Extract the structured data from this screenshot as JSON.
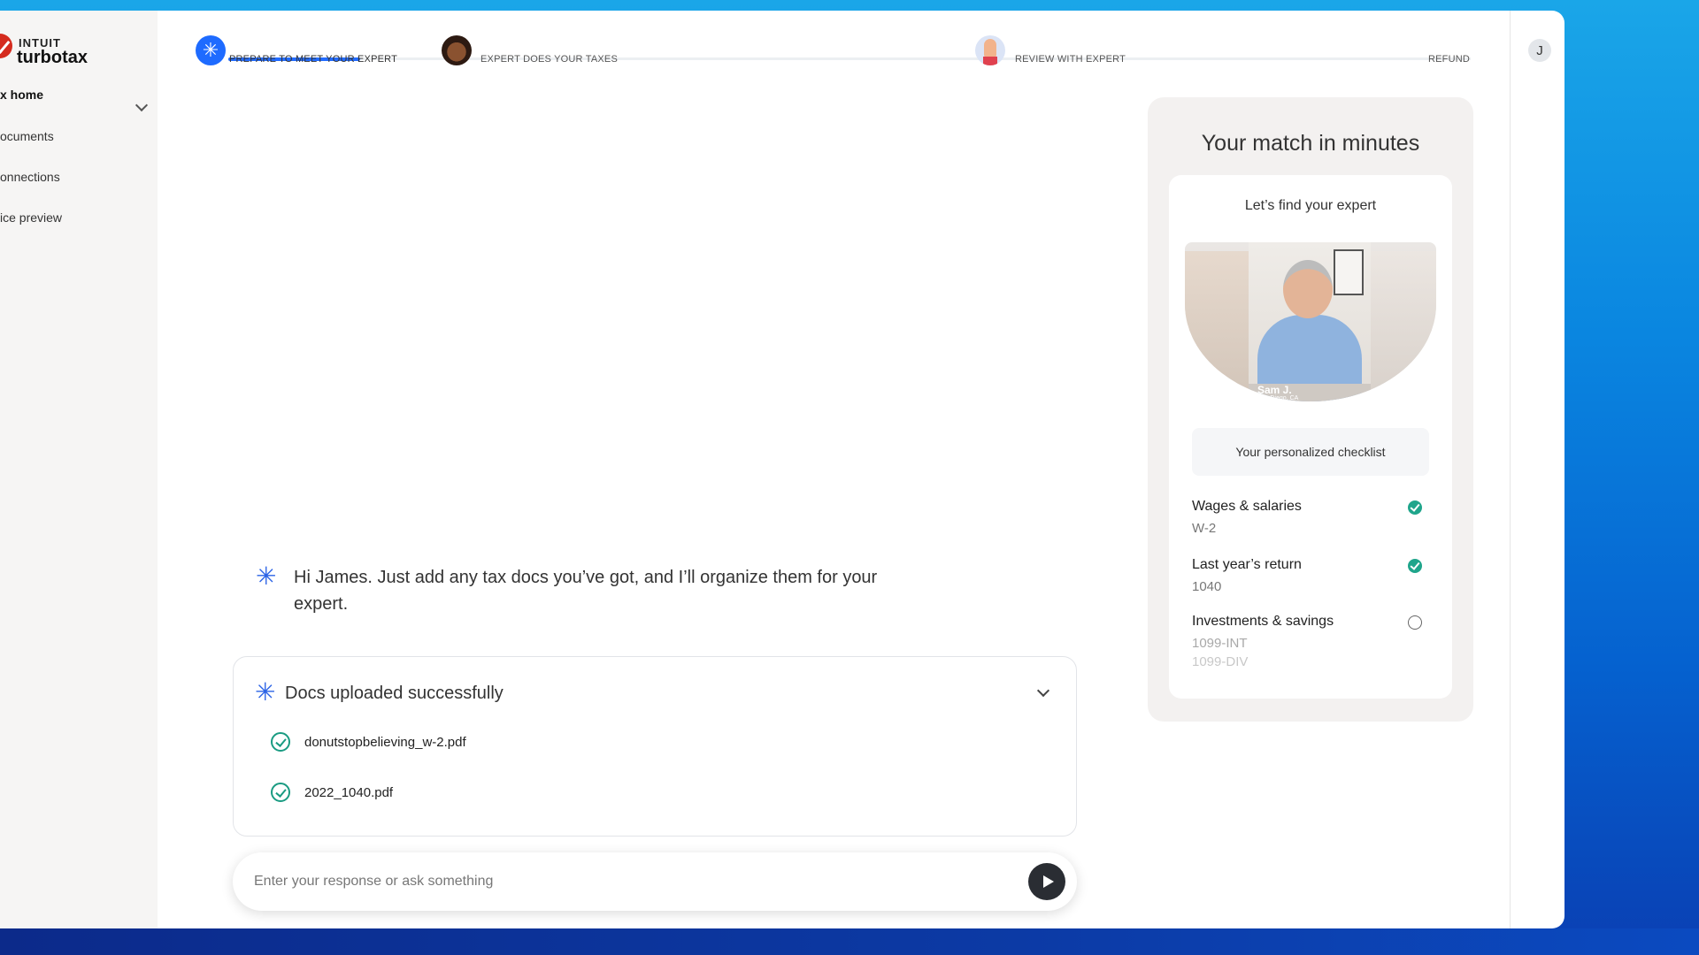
{
  "brand": {
    "top": "INTUIT",
    "name": "turbotax"
  },
  "sidebar": {
    "items": [
      {
        "label": "x home",
        "active": true
      },
      {
        "label": "ocuments"
      },
      {
        "label": "onnections"
      },
      {
        "label": "ice preview"
      }
    ]
  },
  "steps": [
    {
      "label": "PREPARE TO MEET YOUR EXPERT"
    },
    {
      "label": "EXPERT DOES YOUR TAXES"
    },
    {
      "label": "REVIEW WITH EXPERT"
    },
    {
      "label": "REFUND"
    }
  ],
  "progress_fraction_step1": 0.55,
  "user": {
    "initial": "J"
  },
  "chat": {
    "greeting": "Hi James. Just add any tax docs you’ve got, and I’ll organize them for your expert.",
    "docs_title": "Docs uploaded successfully",
    "docs": [
      {
        "name": "donutstopbelieving_w-2.pdf"
      },
      {
        "name": "2022_1040.pdf"
      }
    ],
    "input_placeholder": "Enter your response or ask something"
  },
  "match": {
    "title": "Your match in minutes",
    "subtitle": "Let’s find your expert",
    "expert_name": "Sam J.",
    "expert_location": "San Diego, CA",
    "checklist_title": "Your personalized checklist",
    "items": [
      {
        "label": "Wages & salaries",
        "sub": [
          "W-2"
        ],
        "done": true
      },
      {
        "label": "Last year’s return",
        "sub": [
          "1040"
        ],
        "done": true
      },
      {
        "label": "Investments & savings",
        "sub": [
          "1099-INT",
          "1099-DIV"
        ],
        "done": false
      }
    ]
  },
  "colors": {
    "accent": "#236cff",
    "success": "#1fa58b",
    "brand_red": "#d52b1e"
  },
  "icons": {
    "ai": "sparkle-icon",
    "send": "send-icon",
    "expand": "chevron-down-icon"
  }
}
